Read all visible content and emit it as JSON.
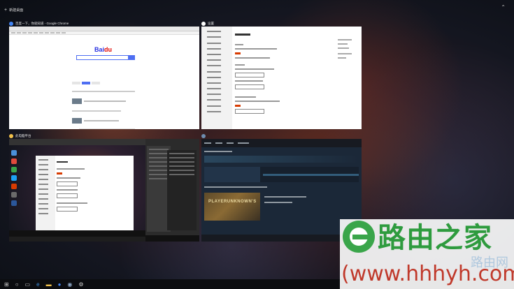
{
  "desktop": {
    "new_desktop_label": "新建桌面",
    "new_desktop_icon": "plus-icon",
    "collapse_icon": "chevron-up-icon"
  },
  "windows": [
    {
      "id": "chrome",
      "title": "百度一下，你就知道 - Google Chrome",
      "icon": "chrome-icon",
      "icon_color": "#4285f4"
    },
    {
      "id": "settings",
      "title": "设置",
      "icon": "settings-icon",
      "icon_color": "#ffffff"
    },
    {
      "id": "explorer",
      "title": "此电脑平台",
      "icon": "folder-icon",
      "icon_color": "#f0c14b"
    },
    {
      "id": "steam",
      "title": "",
      "icon": "steam-icon",
      "icon_color": "#6e8db0"
    }
  ],
  "chrome_page": {
    "logo_a": "Bai",
    "logo_b": "du"
  },
  "steam_page": {
    "game_art_label": "PLAYERUNKNOWN'S"
  },
  "taskbar": {
    "icons": [
      "windows-icon",
      "cortana-icon",
      "task-view-icon",
      "edge-icon",
      "explorer-icon",
      "chrome-icon",
      "steam-icon",
      "settings-icon"
    ]
  },
  "watermark": {
    "title": "路由之家",
    "url": "(www.hhhyh.com)",
    "faint": "路由网",
    "brand_color": "#2e9b3e",
    "url_color": "#c0392b"
  }
}
